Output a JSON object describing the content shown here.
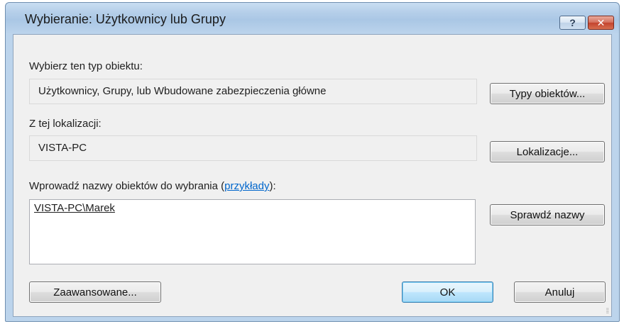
{
  "window": {
    "title": "Wybieranie: Użytkownicy lub Grupy",
    "help_label": "?",
    "close_label": "✕"
  },
  "object_type": {
    "label": "Wybierz ten typ obiektu:",
    "value": "Użytkownicy, Grupy, lub Wbudowane zabezpieczenia główne",
    "button_label": "Typy obiektów..."
  },
  "location": {
    "label": "Z tej lokalizacji:",
    "value": "VISTA-PC",
    "button_label": "Lokalizacje..."
  },
  "names": {
    "label_prefix": "Wprowadź nazwy obiektów do wybrania (",
    "examples_link": "przykłady",
    "label_suffix": "):",
    "value": "VISTA-PC\\Marek",
    "check_button_label": "Sprawdź nazwy"
  },
  "footer": {
    "advanced_label": "Zaawansowane...",
    "ok_label": "OK",
    "cancel_label": "Anuluj"
  },
  "colors": {
    "title_bar": "#b7d0ea",
    "dialog_bg": "#f0f0f0",
    "link": "#0066cc",
    "close_button": "#c4432d",
    "default_button_border": "#3c7fb1"
  }
}
